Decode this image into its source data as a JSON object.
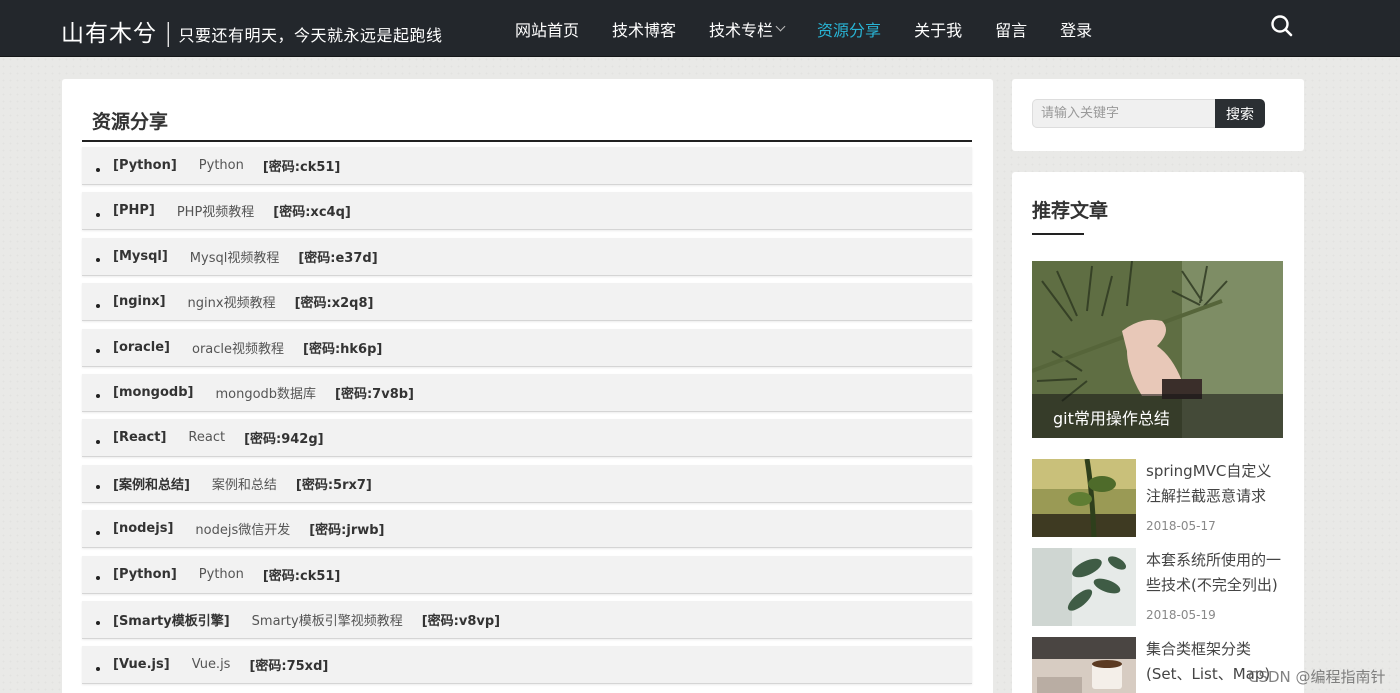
{
  "header": {
    "brand_name": "山有木兮",
    "brand_sep": "|",
    "brand_slogan": "只要还有明天，今天就永远是起跑线",
    "nav": [
      {
        "label": "网站首页"
      },
      {
        "label": "技术博客"
      },
      {
        "label": "技术专栏",
        "has_dropdown": true
      },
      {
        "label": "资源分享",
        "active": true
      },
      {
        "label": "关于我"
      },
      {
        "label": "留言"
      },
      {
        "label": "登录"
      }
    ],
    "search_icon": "search-icon",
    "active_color": "#28b3d4"
  },
  "main": {
    "title": "资源分享",
    "resources": [
      {
        "tag": "[Python]",
        "desc": "Python",
        "code": "[密码:ck51]"
      },
      {
        "tag": "[PHP]",
        "desc": "PHP视频教程",
        "code": "[密码:xc4q]"
      },
      {
        "tag": "[Mysql]",
        "desc": "Mysql视频教程",
        "code": "[密码:e37d]"
      },
      {
        "tag": "[nginx]",
        "desc": "nginx视频教程",
        "code": "[密码:x2q8]"
      },
      {
        "tag": "[oracle]",
        "desc": "oracle视频教程",
        "code": "[密码:hk6p]"
      },
      {
        "tag": "[mongodb]",
        "desc": "mongodb数据库",
        "code": "[密码:7v8b]"
      },
      {
        "tag": "[React]",
        "desc": "React",
        "code": "[密码:942g]"
      },
      {
        "tag": "[案例和总结]",
        "desc": "案例和总结",
        "code": "[密码:5rx7]"
      },
      {
        "tag": "[nodejs]",
        "desc": "nodejs微信开发",
        "code": "[密码:jrwb]"
      },
      {
        "tag": "[Python]",
        "desc": "Python",
        "code": "[密码:ck51]"
      },
      {
        "tag": "[Smarty模板引擎]",
        "desc": "Smarty模板引擎视频教程",
        "code": "[密码:v8vp]"
      },
      {
        "tag": "[Vue.js]",
        "desc": "Vue.js",
        "code": "[密码:75xd]"
      }
    ]
  },
  "sidebar": {
    "search": {
      "placeholder": "请输入关键字",
      "button": "搜索"
    },
    "recommend": {
      "title": "推荐文章",
      "featured": {
        "caption": "git常用操作总结"
      },
      "items": [
        {
          "title": "springMVC自定义注解拦截恶意请求",
          "date": "2018-05-17"
        },
        {
          "title": "本套系统所使用的一些技术(不完全列出)",
          "date": "2018-05-19"
        },
        {
          "title": "集合类框架分类(Set、List、Map)",
          "date": ""
        }
      ]
    }
  },
  "watermark": "CSDN @编程指南针"
}
